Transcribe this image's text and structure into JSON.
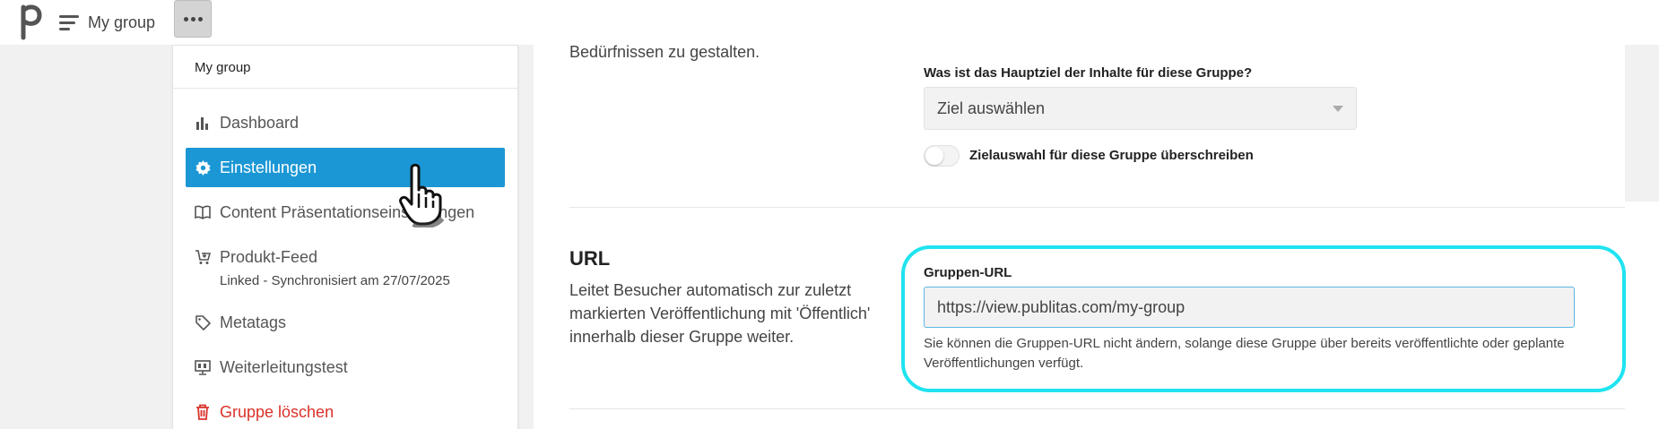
{
  "topbar": {
    "app_title": "My group"
  },
  "menu": {
    "header": "My group",
    "items": [
      {
        "label": "Dashboard",
        "icon": "bar-chart-icon"
      },
      {
        "label": "Einstellungen",
        "icon": "gear-icon"
      },
      {
        "label": "Content Präsentationseinstellungen",
        "icon": "book-open-icon"
      },
      {
        "label": "Produkt-Feed",
        "icon": "cart-icon",
        "sub": "Linked - Synchronisiert am 27/07/2025"
      },
      {
        "label": "Metatags",
        "icon": "tag-icon"
      },
      {
        "label": "Weiterleitungstest",
        "icon": "monitor-icon"
      },
      {
        "label": "Gruppe löschen",
        "icon": "trash-icon"
      }
    ]
  },
  "goal": {
    "intro_tail": "Bedürfnissen zu gestalten.",
    "label": "Was ist das Hauptziel der Inhalte für diese Gruppe?",
    "selected": "Ziel auswählen",
    "override_label": "Zielauswahl für diese Gruppe überschreiben"
  },
  "url_section": {
    "title": "URL",
    "description": "Leitet Besucher automatisch zur zuletzt markierten Veröffentlichung mit 'Öffentlich' innerhalb dieser Gruppe weiter.",
    "field_label": "Gruppen-URL",
    "value": "https://view.publitas.com/my-group",
    "help": "Sie können die Gruppen-URL nicht ändern, solange diese Gruppe über bereits veröffentlichte oder geplante Veröffentlichungen verfügt."
  },
  "colors": {
    "accent": "#1c97d5",
    "danger": "#d9322a",
    "highlight": "#1fe3f0"
  }
}
